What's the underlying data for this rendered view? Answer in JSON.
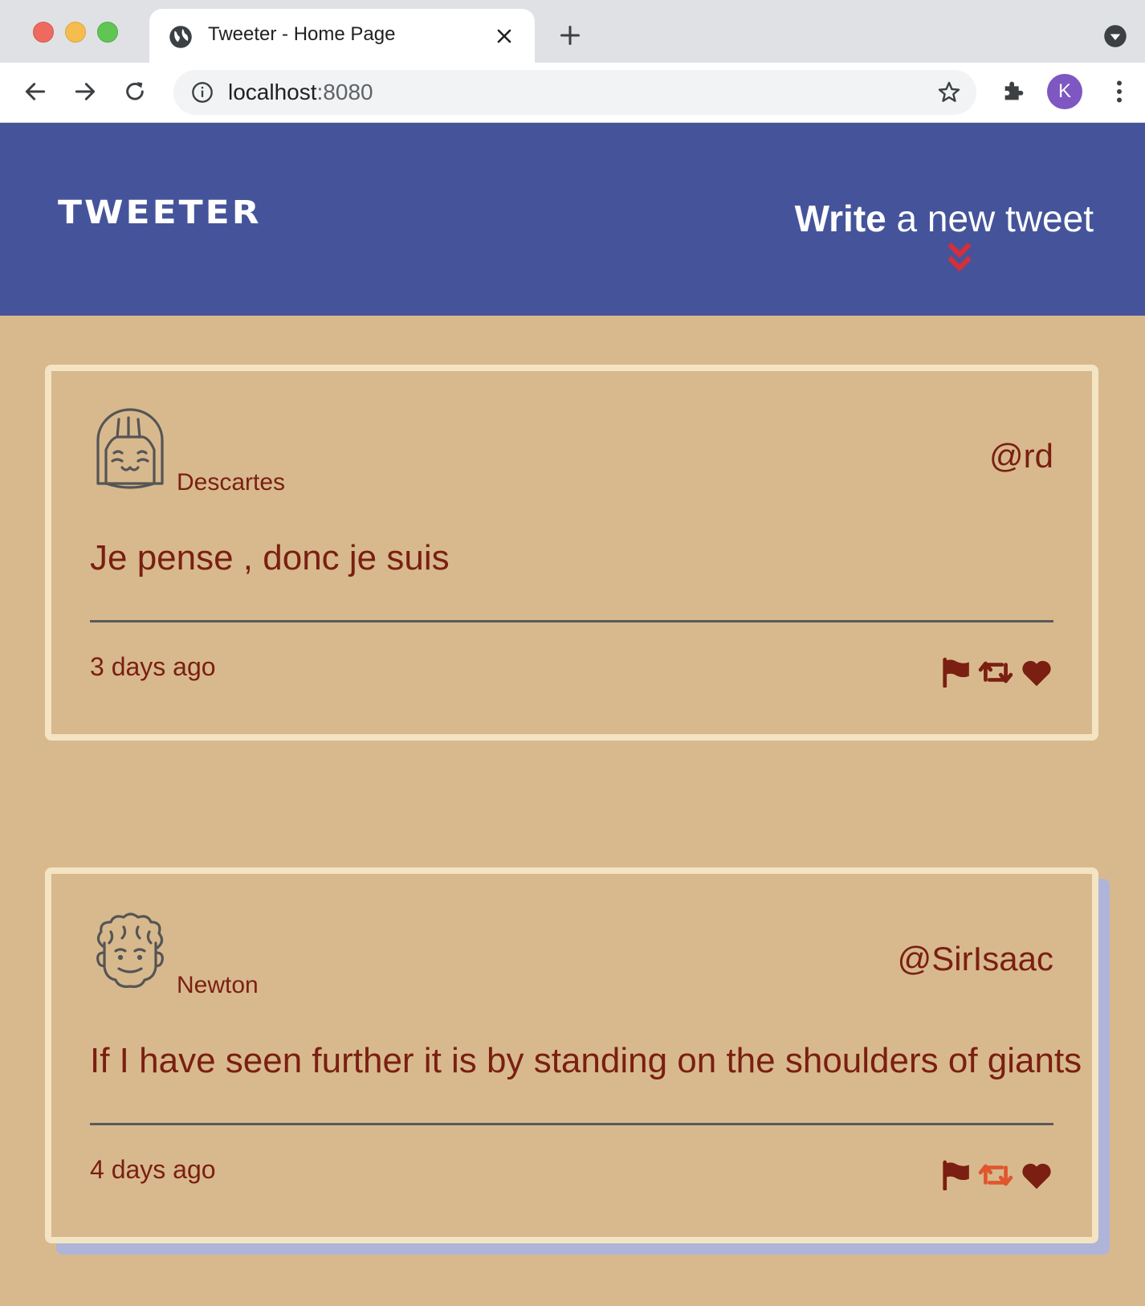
{
  "browser": {
    "tab_title": "Tweeter - Home Page",
    "url_host": "localhost",
    "url_port": ":8080",
    "profile_initial": "K"
  },
  "header": {
    "brand": "TWEETER",
    "compose_strong": "Write",
    "compose_rest": " a new tweet"
  },
  "tweets": [
    {
      "name": "Descartes",
      "handle": "@rd",
      "text": "Je pense , donc je suis",
      "time": "3 days ago",
      "avatar_icon": "girl-face-icon",
      "retweet_color": "#7a1f12"
    },
    {
      "name": "Newton",
      "handle": "@SirIsaac",
      "text": "If I have seen further it is by standing on the shoulders of giants",
      "time": "4 days ago",
      "avatar_icon": "curly-hair-face-icon",
      "retweet_color": "#e0562c"
    }
  ],
  "colors": {
    "header_bg": "#45549a",
    "page_bg": "#d8b98d",
    "text_accent": "#7a1f12",
    "arrow_accent": "#d42f3a",
    "tweet_border": "#f3e4c3",
    "hover_shadow": "#aeb5d8"
  }
}
